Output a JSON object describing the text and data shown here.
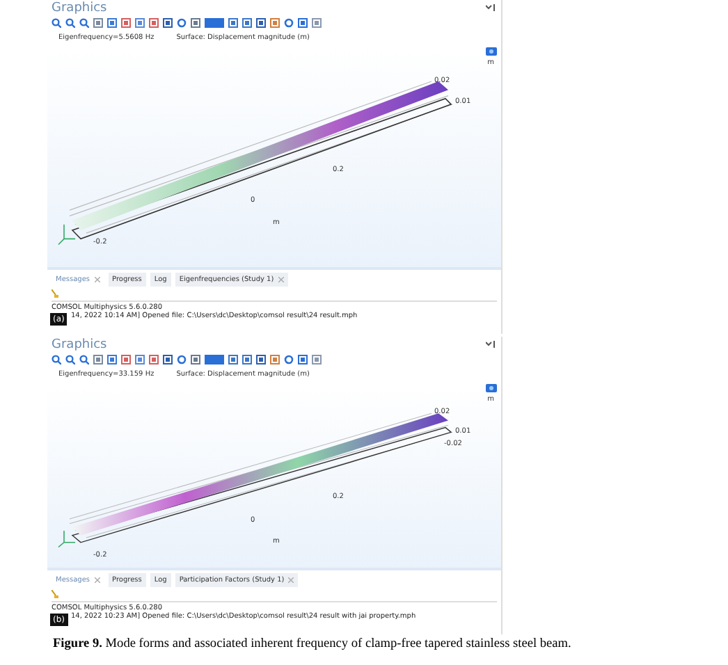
{
  "panels": [
    {
      "label": "(a)",
      "title": "Graphics",
      "eigenfrequency": "Eigenfrequency=5.5608 Hz",
      "surface": "Surface: Displacement magnitude (m)",
      "unit": "m",
      "axis_labels": [
        "0.02",
        "0.01",
        "0.2",
        "0",
        "m",
        "-0.2"
      ],
      "tabs": [
        {
          "label": "Messages",
          "selected": true,
          "closable": true
        },
        {
          "label": "Progress",
          "selected": false,
          "closable": false
        },
        {
          "label": "Log",
          "selected": false,
          "closable": false
        },
        {
          "label": "Eigenfrequencies (Study 1)",
          "selected": false,
          "closable": true
        }
      ],
      "log": [
        "COMSOL Multiphysics 5.6.0.280",
        "14, 2022 10:14 AM] Opened file: C:\\Users\\dc\\Desktop\\comsol result\\24 result.mph"
      ]
    },
    {
      "label": "(b)",
      "title": "Graphics",
      "eigenfrequency": "Eigenfrequency=33.159 Hz",
      "surface": "Surface: Displacement magnitude (m)",
      "unit": "m",
      "axis_labels": [
        "0.02",
        "0.01",
        "-0.02",
        "0.2",
        "0",
        "m",
        "-0.2"
      ],
      "tabs": [
        {
          "label": "Messages",
          "selected": true,
          "closable": true
        },
        {
          "label": "Progress",
          "selected": false,
          "closable": false
        },
        {
          "label": "Log",
          "selected": false,
          "closable": false
        },
        {
          "label": "Participation Factors (Study 1)",
          "selected": false,
          "closable": true
        }
      ],
      "log": [
        "COMSOL Multiphysics 5.6.0.280",
        "14, 2022 10:23 AM] Opened file: C:\\Users\\dc\\Desktop\\comsol result\\24 result with jai property.mph"
      ]
    }
  ],
  "caption": "**Figure 9.** Mode forms and associated inherent frequency of clamp-free tapered stainless steel beam."
}
